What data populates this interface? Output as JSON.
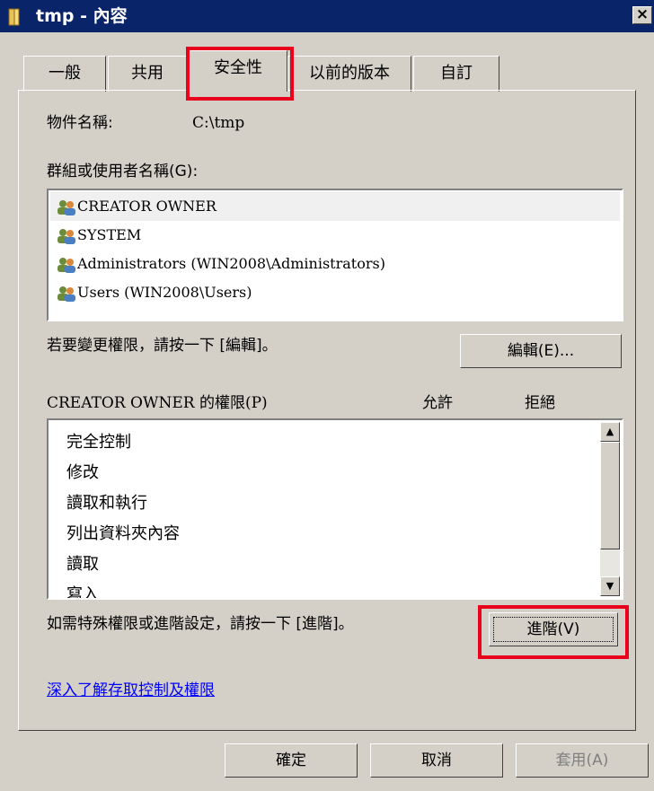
{
  "window": {
    "title": "tmp - 內容",
    "close_label": "×"
  },
  "tabs": [
    {
      "label": "一般"
    },
    {
      "label": "共用"
    },
    {
      "label": "安全性"
    },
    {
      "label": "以前的版本"
    },
    {
      "label": "自訂"
    }
  ],
  "active_tab": "安全性",
  "object": {
    "label": "物件名稱:",
    "value": "C:\\tmp"
  },
  "groups": {
    "label": "群組或使用者名稱(G):",
    "items": [
      {
        "name": "CREATOR OWNER",
        "selected": true
      },
      {
        "name": "SYSTEM"
      },
      {
        "name": "Administrators (WIN2008\\Administrators)"
      },
      {
        "name": "Users (WIN2008\\Users)"
      }
    ]
  },
  "change_hint": "若要變更權限，請按一下 [編輯]。",
  "edit_button": "編輯(E)...",
  "permissions": {
    "label": "CREATOR OWNER 的權限(P)",
    "allow_header": "允許",
    "deny_header": "拒絕",
    "items": [
      "完全控制",
      "修改",
      "讀取和執行",
      "列出資料夾內容",
      "讀取",
      "寫入"
    ]
  },
  "advanced_hint": "如需特殊權限或進階設定，請按一下 [進階]。",
  "advanced_button": "進階(V)",
  "learn_more_link": "深入了解存取控制及權限",
  "footer": {
    "ok": "確定",
    "cancel": "取消",
    "apply": "套用(A)"
  },
  "colors": {
    "title_bar": "#0a246a",
    "highlight": "#e8001c",
    "link": "#0000ff"
  }
}
